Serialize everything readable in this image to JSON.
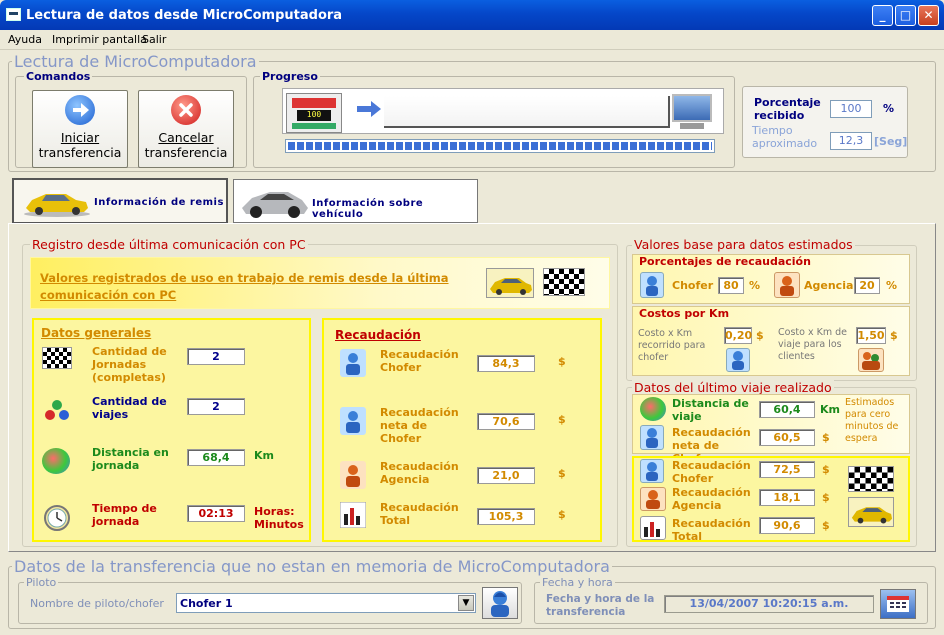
{
  "window": {
    "title": "Lectura de datos desde MicroComputadora"
  },
  "menu": [
    "Ayuda",
    "Imprimir pantalla",
    "Salir"
  ],
  "lectura": {
    "title": "Lectura de MicroComputadora",
    "comandos": "Comandos",
    "iniciar_line1": "Iniciar",
    "iniciar_line2": "transferencia",
    "cancelar_line1": "Cancelar",
    "cancelar_line2": "transferencia",
    "progreso": "Progreso",
    "progress_fraction": 1.0,
    "device_display": "100",
    "porcentaje_label": "Porcentaje recibido",
    "porcentaje_value": "100",
    "porcentaje_unit": "%",
    "tiempo_label": "Tiempo aproximado",
    "tiempo_value": "12,3",
    "tiempo_unit": "[Seg]"
  },
  "tabs": [
    {
      "label": "Información de remis",
      "icon": "yellow-car-icon"
    },
    {
      "label": "Información sobre vehículo",
      "icon": "silver-car-icon"
    }
  ],
  "registro": {
    "title": "Registro desde última comunicación con PC",
    "header": "Valores registrados de uso en trabajo de remis desde la última comunicación con PC",
    "datos_generales": {
      "title": "Datos generales",
      "rows": [
        {
          "label": "Cantidad de Jornadas (completas)",
          "value": "2",
          "unit": "",
          "color": "orange",
          "icon": "checkered-flag-icon"
        },
        {
          "label": "Cantidad de viajes",
          "value": "2",
          "unit": "",
          "color": "blue",
          "icon": "molecule-icon"
        },
        {
          "label": "Distancia en jornada",
          "value": "68,4",
          "unit": "Km",
          "color": "green",
          "icon": "globe-icon"
        },
        {
          "label": "Tiempo de jornada",
          "value": "02:13",
          "unit": "Horas: Minutos",
          "color": "red",
          "icon": "clock-icon"
        }
      ]
    },
    "recaudacion": {
      "title": "Recaudación",
      "rows": [
        {
          "label": "Recaudación Chofer",
          "value": "84,3",
          "unit": "$",
          "icon": "driver-icon"
        },
        {
          "label": "Recaudación neta de Chofer",
          "value": "70,6",
          "unit": "$",
          "icon": "driver-icon"
        },
        {
          "label": "Recaudación Agencia",
          "value": "21,0",
          "unit": "$",
          "icon": "agency-person-icon"
        },
        {
          "label": "Recaudación Total",
          "value": "105,3",
          "unit": "$",
          "icon": "bar-chart-icon"
        }
      ]
    }
  },
  "valores_base": {
    "title": "Valores base para datos estimados",
    "porcentajes_title": "Porcentajes de recaudación",
    "chofer_label": "Chofer",
    "chofer_value": "80",
    "agencia_label": "Agencia",
    "agencia_value": "20",
    "pct": "%",
    "costos_title": "Costos por Km",
    "costo_chofer_label": "Costo x Km recorrido para chofer",
    "costo_chofer_value": "0,20",
    "costo_viaje_label": "Costo x Km de viaje para los clientes",
    "costo_viaje_value": "1,50",
    "currency": "$"
  },
  "ultimo_viaje": {
    "title": "Datos del último viaje realizado",
    "distancia_label": "Distancia de viaje",
    "distancia_value": "60,4",
    "distancia_unit": "Km",
    "estimados_note": "Estimados para cero minutos de espera",
    "neta_label": "Recaudación neta de Chofer",
    "neta_value": "60,5",
    "chofer_label": "Recaudación Chofer",
    "chofer_value": "72,5",
    "agencia_label": "Recaudación Agencia",
    "agencia_value": "18,1",
    "total_label": "Recaudación Total",
    "total_value": "90,6",
    "currency": "$"
  },
  "transferencia": {
    "title": "Datos de la transferencia que no estan en memoria de MicroComputadora",
    "piloto_legend": "Piloto",
    "piloto_label": "Nombre de piloto/chofer",
    "piloto_value": "Chofer 1",
    "fecha_legend": "Fecha y hora",
    "fecha_label": "Fecha y hora de la transferencia",
    "fecha_value": "13/04/2007 10:20:15 a.m."
  },
  "colors": {
    "titlebar": "#0547c9",
    "panel_yellow": "#ffef60",
    "accent_red": "#c00000",
    "label_orange": "#d28a00"
  }
}
